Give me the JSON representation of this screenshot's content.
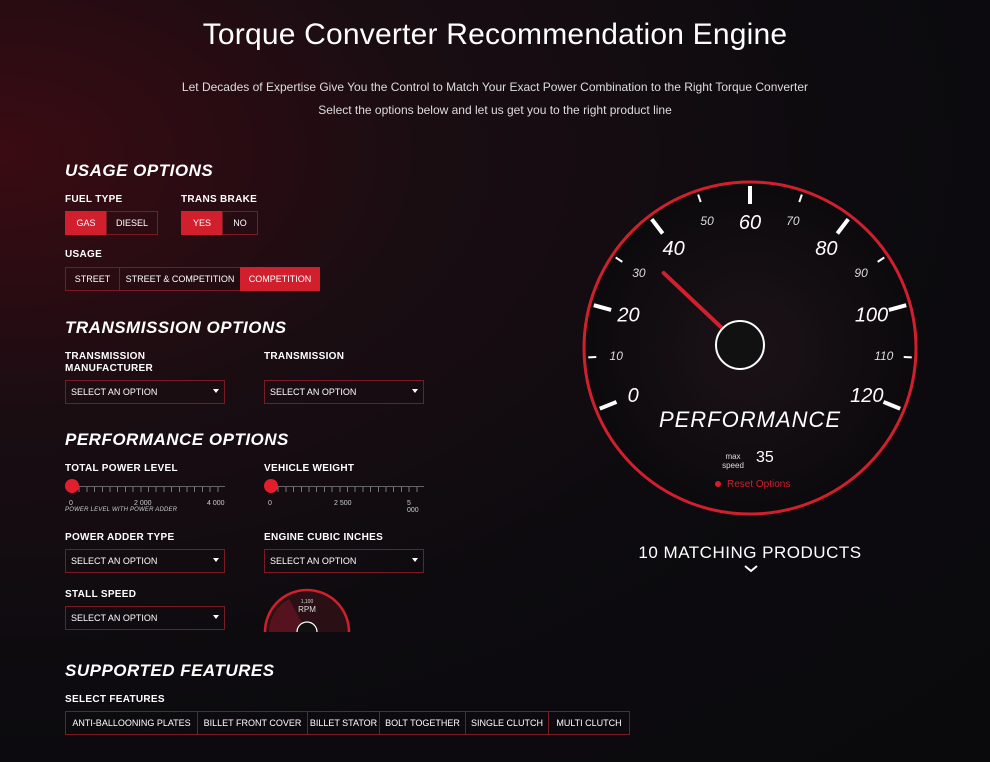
{
  "header": {
    "title": "Torque Converter Recommendation Engine",
    "subtitle1": "Let Decades of Expertise Give You the Control to Match Your Exact Power Combination to the Right Torque Converter",
    "subtitle2": "Select the options below and let us get you to the right product line"
  },
  "usage": {
    "section_title": "USAGE OPTIONS",
    "fuel_type_label": "FUEL TYPE",
    "fuel_gas": "GAS",
    "fuel_diesel": "DIESEL",
    "trans_brake_label": "TRANS BRAKE",
    "trans_yes": "YES",
    "trans_no": "NO",
    "usage_label": "USAGE",
    "usage_street": "STREET",
    "usage_street_comp": "STREET & COMPETITION",
    "usage_comp": "COMPETITION"
  },
  "transmission": {
    "section_title": "TRANSMISSION OPTIONS",
    "manufacturer_label_1": "TRANSMISSION",
    "manufacturer_label_2": "MANUFACTURER",
    "transmission_label": "TRANSMISSION",
    "manufacturer_value": "SELECT AN OPTION",
    "transmission_value": "SELECT AN OPTION"
  },
  "performance": {
    "section_title": "PERFORMANCE OPTIONS",
    "power_label": "TOTAL POWER LEVEL",
    "power_ticks": [
      "0",
      "2 000",
      "4 000"
    ],
    "power_note": "POWER LEVEL WITH POWER ADDER",
    "weight_label": "VEHICLE WEIGHT",
    "weight_ticks": [
      "0",
      "2 500",
      "5 000"
    ],
    "power_adder_label": "POWER ADDER TYPE",
    "power_adder_value": "SELECT AN OPTION",
    "cubic_label": "ENGINE CUBIC INCHES",
    "cubic_value": "SELECT AN OPTION",
    "stall_label": "STALL SPEED",
    "stall_value": "SELECT AN OPTION",
    "mini_gauge_top": "1,100",
    "mini_gauge_label": "RPM"
  },
  "features": {
    "section_title": "SUPPORTED FEATURES",
    "select_label": "SELECT FEATURES",
    "items": [
      "ANTI-BALLOONING PLATES",
      "BILLET FRONT COVER",
      "BILLET STATOR",
      "BOLT TOGETHER",
      "SINGLE CLUTCH",
      "MULTI CLUTCH"
    ]
  },
  "gauge": {
    "major_labels": [
      "0",
      "20",
      "40",
      "60",
      "80",
      "100",
      "120"
    ],
    "minor_labels": [
      "10",
      "30",
      "50",
      "70",
      "90",
      "110"
    ],
    "title": "PERFORMANCE",
    "max_speed_label_1": "max",
    "max_speed_label_2": "speed",
    "max_speed_value": "35",
    "reset_label": "Reset Options",
    "accent_color": "#d11f2e",
    "needle_value": 35
  },
  "results": {
    "matching": "10 MATCHING PRODUCTS"
  }
}
